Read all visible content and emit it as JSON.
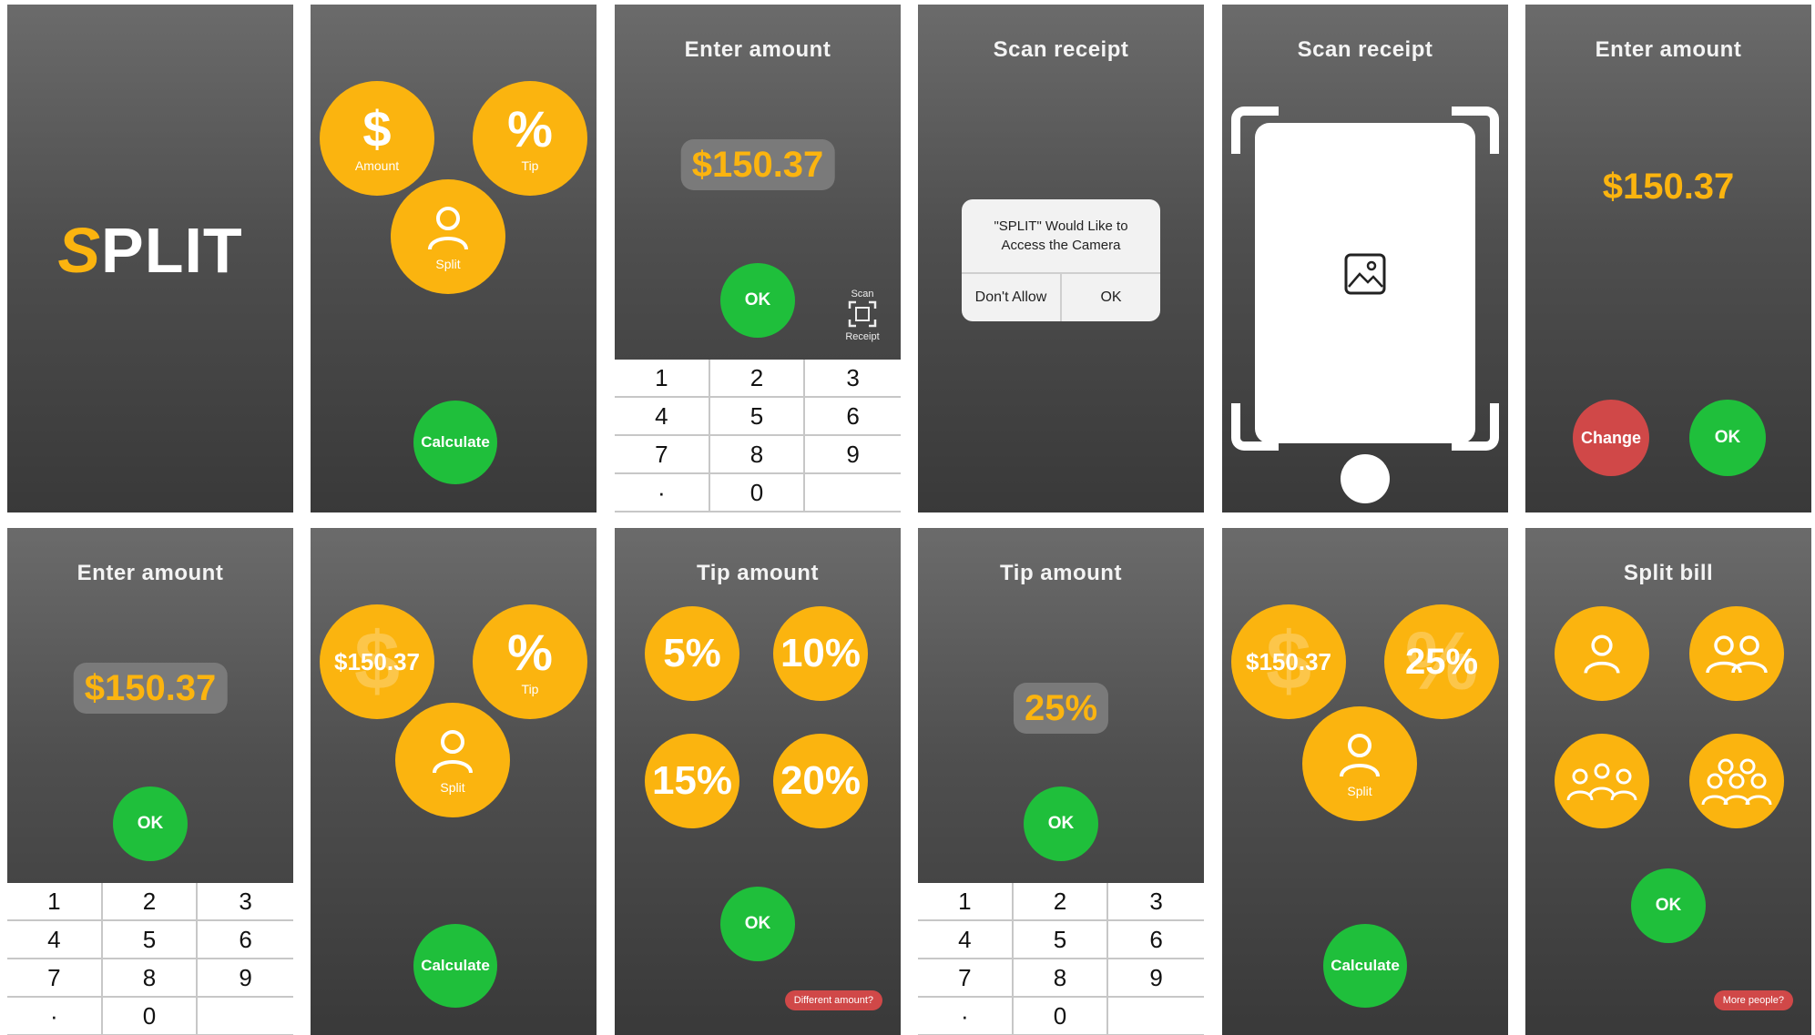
{
  "logo": {
    "mark": "S",
    "rest": "PLIT"
  },
  "menu": {
    "amount_symbol": "$",
    "amount_label": "Amount",
    "tip_symbol": "%",
    "tip_label": "Tip",
    "split_label": "Split",
    "calculate": "Calculate"
  },
  "enter_amount": {
    "title": "Enter amount",
    "value": "$150.37",
    "ok": "OK",
    "scan_top": "Scan",
    "scan_bottom": "Receipt"
  },
  "keypad": [
    "1",
    "2",
    "3",
    "4",
    "5",
    "6",
    "7",
    "8",
    "9",
    "·",
    "0",
    ""
  ],
  "scan": {
    "title": "Scan receipt",
    "dialog_message": "\"SPLIT\" Would Like to Access the Camera",
    "dont_allow": "Don't Allow",
    "ok": "OK"
  },
  "confirm": {
    "title": "Enter amount",
    "value": "$150.37",
    "change": "Change",
    "ok": "OK"
  },
  "menu_filled": {
    "amount_value": "$150.37",
    "tip_symbol": "%",
    "tip_label": "Tip",
    "split_label": "Split",
    "calculate": "Calculate"
  },
  "tip": {
    "title": "Tip amount",
    "options": [
      "5%",
      "10%",
      "15%",
      "20%"
    ],
    "ok": "OK",
    "different": "Different amount?",
    "custom_value": "25%"
  },
  "menu_final": {
    "amount_value": "$150.37",
    "tip_value": "25%",
    "split_label": "Split",
    "calculate": "Calculate"
  },
  "split": {
    "title": "Split bill",
    "ok": "OK",
    "more": "More people?"
  },
  "colors": {
    "accent": "#fbb40f",
    "go": "#1fbf3b",
    "warn": "#d04848"
  }
}
